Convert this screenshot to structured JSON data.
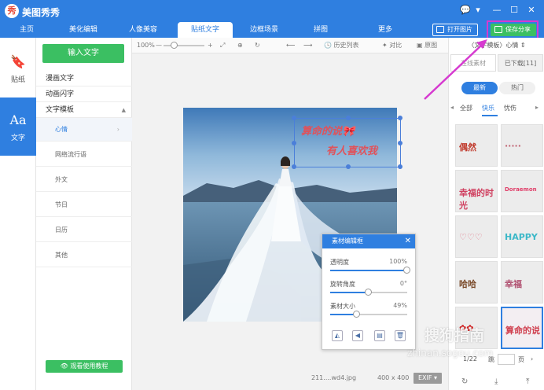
{
  "app": {
    "logo": "秀",
    "title": "美图秀秀"
  },
  "window_controls": [
    "💬",
    "▾",
    "—",
    "☐",
    "✕"
  ],
  "nav": {
    "tabs": [
      "主页",
      "美化编辑",
      "人像美容",
      "贴纸文字",
      "边框场景",
      "拼图",
      "更多"
    ],
    "active_tab": "贴纸文字",
    "open_image": "打开图片",
    "save_share": "保存分享"
  },
  "rail": [
    {
      "label": "贴纸",
      "icon": "sticker-icon"
    },
    {
      "label": "文字",
      "icon": "text-icon",
      "active": true
    }
  ],
  "categories": {
    "input_text_button": "输入文字",
    "main": [
      "漫画文字",
      "动画闪字",
      "文字模板"
    ],
    "expanded": "文字模板",
    "sub": [
      "心情",
      "网络流行语",
      "外文",
      "节日",
      "日历",
      "其他"
    ],
    "active_sub": "心情",
    "tutorial_button": "观看使用教程"
  },
  "toolbar": {
    "zoom": "100%",
    "zoom_level": 0.25,
    "minus": "—",
    "plus": "+",
    "history": "历史列表",
    "compare": "对比",
    "original": "原图"
  },
  "sticker": {
    "line1": "算命的说🎀",
    "line2": "有人喜欢我"
  },
  "status": {
    "filename": "211....wd4.jpg",
    "size": "400 x 400",
    "exif": "EXIF"
  },
  "dialog": {
    "title": "素材编辑框",
    "sliders": [
      {
        "label": "透明度",
        "value": "100%",
        "level": 1.0
      },
      {
        "label": "旋转角度",
        "value": "0°",
        "level": 0.5
      },
      {
        "label": "素材大小",
        "value": "49%",
        "level": 0.35
      }
    ]
  },
  "right_panel": {
    "breadcrumb": "〈文字模板〉心情",
    "source_tabs": [
      "在线素材",
      "已下载[11]"
    ],
    "pills": [
      "最新",
      "热门"
    ],
    "subtabs": [
      "全部",
      "快乐",
      "忧伤"
    ],
    "active_subtab": "快乐",
    "thumbs": [
      {
        "text": "偶然",
        "color": "#c0392b"
      },
      {
        "text": "·····",
        "color": "#c06070"
      },
      {
        "text": "幸福的时光",
        "color": "#d04060"
      },
      {
        "text": "Doraemon",
        "color": "#e0406a"
      },
      {
        "text": "♡♡♡",
        "color": "#e07a8a"
      },
      {
        "text": "HAPPY",
        "color": "#3cb8c8"
      },
      {
        "text": "哈哈",
        "color": "#7a4a2a"
      },
      {
        "text": "幸福",
        "color": "#b05070"
      },
      {
        "text": "✿✿",
        "color": "#d02020"
      },
      {
        "text": "算命的说",
        "color": "#d04050"
      }
    ],
    "pager": {
      "current": "1/22",
      "label_page": "页",
      "jump": "跳"
    }
  },
  "watermark": {
    "text": "搜狗指南",
    "url": "zhinan.sogou.com"
  }
}
